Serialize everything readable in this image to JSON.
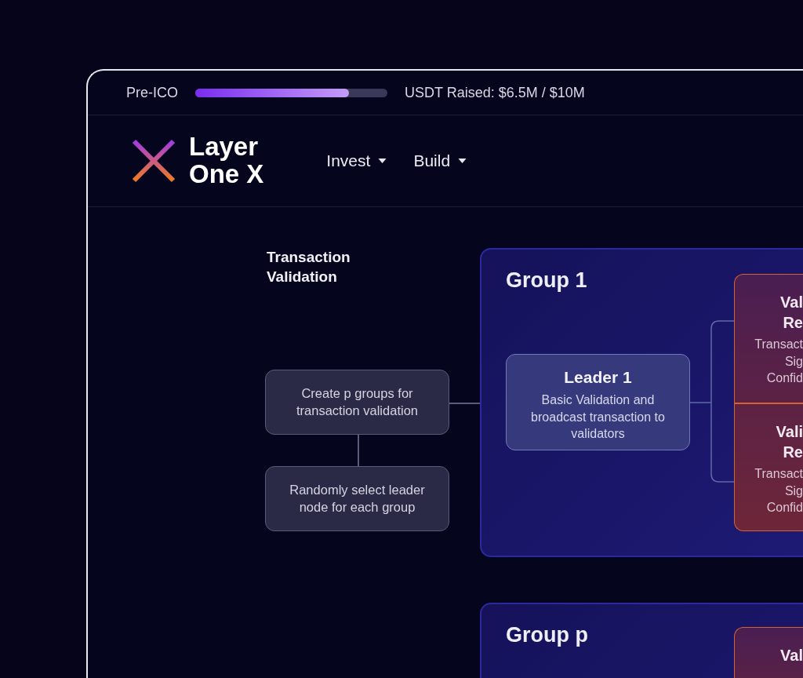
{
  "topbar": {
    "stage": "Pre-ICO",
    "level": 0.8,
    "raised": "USDT Raised: $6.5M / $10M"
  },
  "brand": {
    "line1": "Layer",
    "line2": "One X"
  },
  "nav": [
    {
      "label": "Invest"
    },
    {
      "label": "Build"
    }
  ],
  "diagram": {
    "title": "Transaction Validation",
    "steps": [
      "Create p groups for transaction validation",
      "Randomly select leader node for each group"
    ],
    "groups": [
      {
        "title": "Group 1",
        "leader": {
          "title": "Leader 1",
          "text": "Basic Validation and broadcast transaction to validators"
        },
        "validators": [
          {
            "lines": [
              "Val",
              "Re"
            ],
            "detail": [
              "Transact",
              "Sig",
              "Confid"
            ]
          },
          {
            "lines": [
              "Vali",
              "Re"
            ],
            "detail": [
              "Transact",
              "Sig",
              "Confid"
            ]
          }
        ]
      },
      {
        "title": "Group p",
        "validators": [
          {
            "lines": [
              "Val"
            ]
          }
        ]
      }
    ]
  }
}
